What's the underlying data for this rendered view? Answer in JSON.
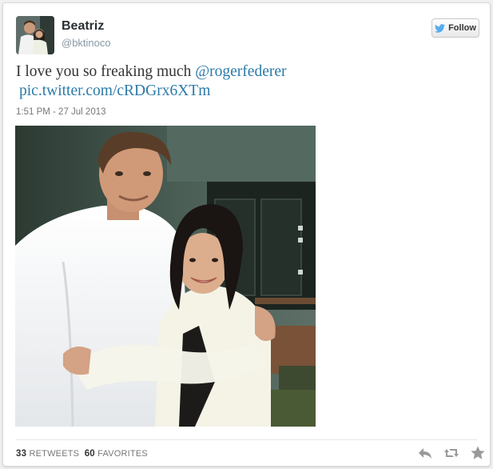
{
  "user": {
    "name": "Beatriz",
    "handle": "@bktinoco"
  },
  "follow": {
    "label": "Follow",
    "icon": "twitter-bird-icon",
    "accent": "#55acee"
  },
  "tweet": {
    "text": "I love you so freaking much ",
    "mention": "@rogerfederer",
    "link": "pic.twitter.com/cRDGrx6XTm",
    "timestamp": "1:51 PM - 27 Jul 2013",
    "link_color": "#2a7aa8"
  },
  "stats": {
    "retweets_count": "33",
    "retweets_label": "RETWEETS",
    "favorites_count": "60",
    "favorites_label": "FAVORITES"
  },
  "actions": {
    "reply_icon": "reply-icon",
    "retweet_icon": "retweet-icon",
    "favorite_icon": "star-icon"
  }
}
